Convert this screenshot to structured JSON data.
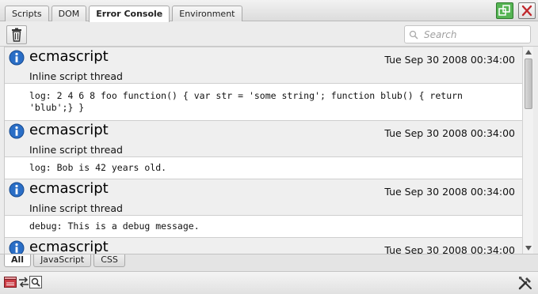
{
  "tabs": [
    {
      "label": "Scripts",
      "active": false
    },
    {
      "label": "DOM",
      "active": false
    },
    {
      "label": "Error Console",
      "active": true
    },
    {
      "label": "Environment",
      "active": false
    }
  ],
  "window_buttons": {
    "dock_icon": "dock-window-icon",
    "close_icon": "close-icon",
    "dock_color": "#55b453",
    "close_color": "#c0282d"
  },
  "toolbar": {
    "clear_icon": "trash-icon",
    "search_placeholder": "Search"
  },
  "entries": [
    {
      "source": "ecmascript",
      "date": "Tue Sep 30 2008 00:34:00",
      "context": "Inline script thread",
      "message": "log: 2 4 6 8 foo function() { var str = 'some string'; function blub() { return\n'blub';} }"
    },
    {
      "source": "ecmascript",
      "date": "Tue Sep 30 2008 00:34:00",
      "context": "Inline script thread",
      "message": "log: Bob is 42 years old."
    },
    {
      "source": "ecmascript",
      "date": "Tue Sep 30 2008 00:34:00",
      "context": "Inline script thread",
      "message": "debug: This is a debug message."
    },
    {
      "source": "ecmascript",
      "date": "Tue Sep 30 2008 00:34:00",
      "context": "",
      "message": ""
    }
  ],
  "filters": [
    {
      "label": "All",
      "active": true
    },
    {
      "label": "JavaScript",
      "active": false
    },
    {
      "label": "CSS",
      "active": false
    }
  ],
  "statusbar": {
    "left_icons": [
      "debugger-window-icon",
      "swap-arrows-icon",
      "inspect-magnifier-icon"
    ],
    "right_icon": "settings-tools-icon"
  },
  "colors": {
    "info_icon": "#2a6ec6",
    "entry_header_bg": "#efefef",
    "accent_green": "#55b453"
  }
}
